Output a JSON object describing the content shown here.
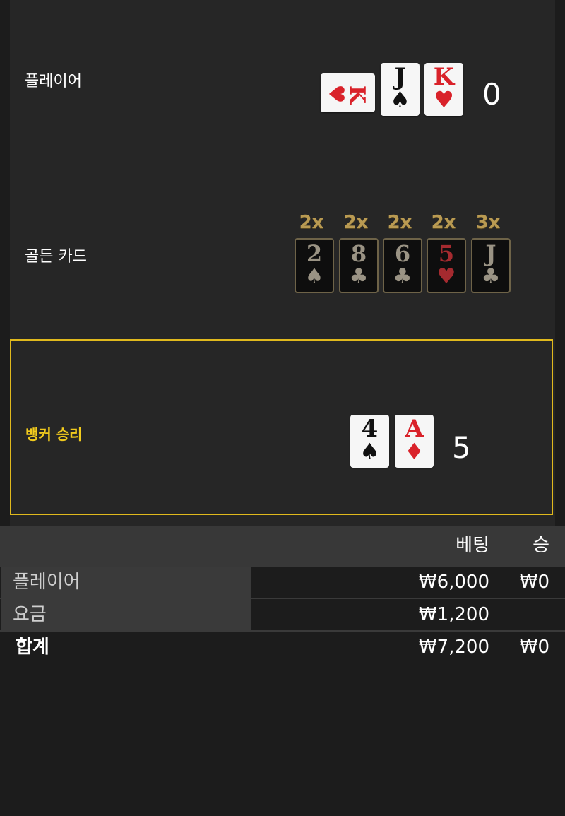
{
  "player": {
    "label": "플레이어",
    "cards": [
      {
        "rank": "K",
        "suit": "♥",
        "color": "red",
        "orientation": "sideways"
      },
      {
        "rank": "J",
        "suit": "♠",
        "color": "black"
      },
      {
        "rank": "K",
        "suit": "♥",
        "color": "red"
      }
    ],
    "score": "0"
  },
  "golden_cards": {
    "label": "골든 카드",
    "cards": [
      {
        "multiplier": "2x",
        "rank": "2",
        "suit": "♠"
      },
      {
        "multiplier": "2x",
        "rank": "8",
        "suit": "♣"
      },
      {
        "multiplier": "2x",
        "rank": "6",
        "suit": "♣"
      },
      {
        "multiplier": "2x",
        "rank": "5",
        "suit": "♥"
      },
      {
        "multiplier": "3x",
        "rank": "J",
        "suit": "♣"
      }
    ]
  },
  "banker": {
    "result_label": "뱅커 승리",
    "cards": [
      {
        "rank": "4",
        "suit": "♠",
        "color": "black"
      },
      {
        "rank": "A",
        "suit": "♦",
        "color": "red"
      }
    ],
    "score": "5"
  },
  "results_table": {
    "headers": {
      "bet": "베팅",
      "win": "승"
    },
    "rows": [
      {
        "name": "플레이어",
        "bet": "₩6,000",
        "win": "₩0"
      },
      {
        "name": "요금",
        "bet": "₩1,200",
        "win": ""
      }
    ],
    "total": {
      "name": "합계",
      "bet": "₩7,200",
      "win": "₩0"
    }
  },
  "colors": {
    "win_highlight": "#e0b91d",
    "golden_multiplier": "#b99a52",
    "red_suit": "#d9222a"
  }
}
